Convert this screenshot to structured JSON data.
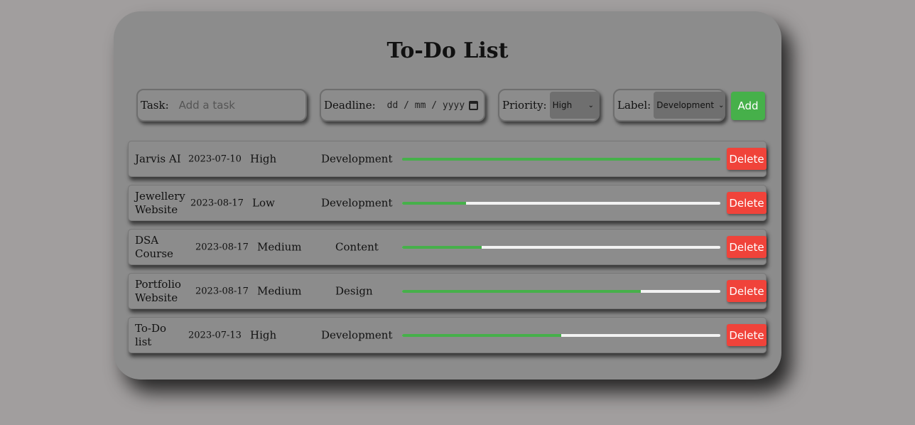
{
  "title": "To-Do List",
  "form": {
    "task_label": "Task:",
    "task_placeholder": "Add a task",
    "deadline_label": "Deadline:",
    "deadline_placeholder": "dd / mm / yyyy",
    "priority_label": "Priority:",
    "priority_value": "High",
    "label_label": "Label:",
    "label_value": "Development",
    "add_label": "Add"
  },
  "colors": {
    "accent": "#46b04a",
    "danger": "#f0433a",
    "card": "#8c8c8c",
    "background": "#a19e9e"
  },
  "delete_label": "Delete",
  "tasks": [
    {
      "name": "Jarvis AI",
      "date": "2023-07-10",
      "priority": "High",
      "label": "Development",
      "progress": 1.0
    },
    {
      "name": "Jewellery Website",
      "date": "2023-08-17",
      "priority": "Low",
      "label": "Development",
      "progress": 0.2
    },
    {
      "name": "DSA Course",
      "date": "2023-08-17",
      "priority": "Medium",
      "label": "Content",
      "progress": 0.25
    },
    {
      "name": "Portfolio Website",
      "date": "2023-08-17",
      "priority": "Medium",
      "label": "Design",
      "progress": 0.75
    },
    {
      "name": "To-Do list",
      "date": "2023-07-13",
      "priority": "High",
      "label": "Development",
      "progress": 0.5
    }
  ]
}
